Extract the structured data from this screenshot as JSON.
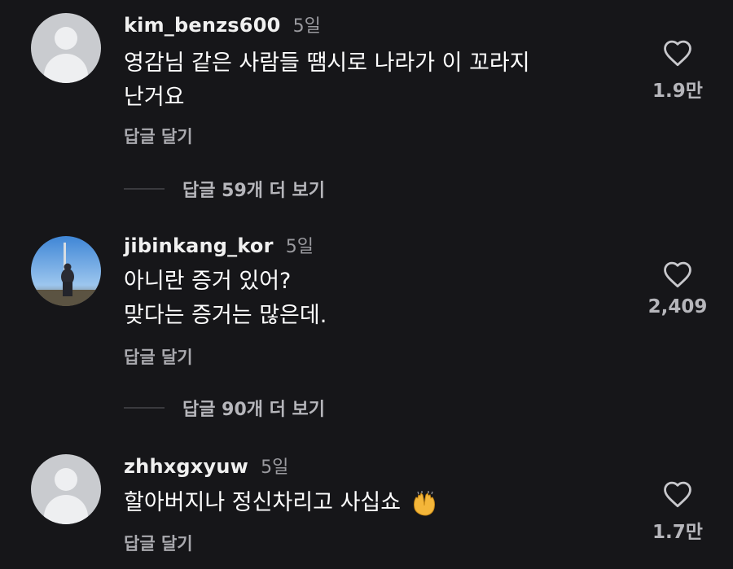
{
  "comments": [
    {
      "username": "kim_benzs600",
      "time": "5일",
      "text": "영감님 같은 사람들 땜시로 나라가 이 꼬라지\n난거요",
      "reply_label": "답글 달기",
      "likes": "1.9만",
      "avatar": "default-avatar",
      "more_replies": "답글 59개 더 보기"
    },
    {
      "username": "jibinkang_kor",
      "time": "5일",
      "text": "아니란 증거 있어?\n맞다는 증거는 많은데.",
      "reply_label": "답글 달기",
      "likes": "2,409",
      "avatar": "photo-avatar",
      "more_replies": "답글 90개 더 보기"
    },
    {
      "username": "zhhxgxyuw",
      "time": "5일",
      "text": "할아버지나 정신차리고 사십쇼",
      "emoji": "raising-hands-emoji",
      "reply_label": "답글 달기",
      "likes": "1.7만",
      "avatar": "default-avatar"
    }
  ],
  "colors": {
    "background": "#161619",
    "username": "#f0f0f0",
    "secondary": "#9a9a9f"
  }
}
